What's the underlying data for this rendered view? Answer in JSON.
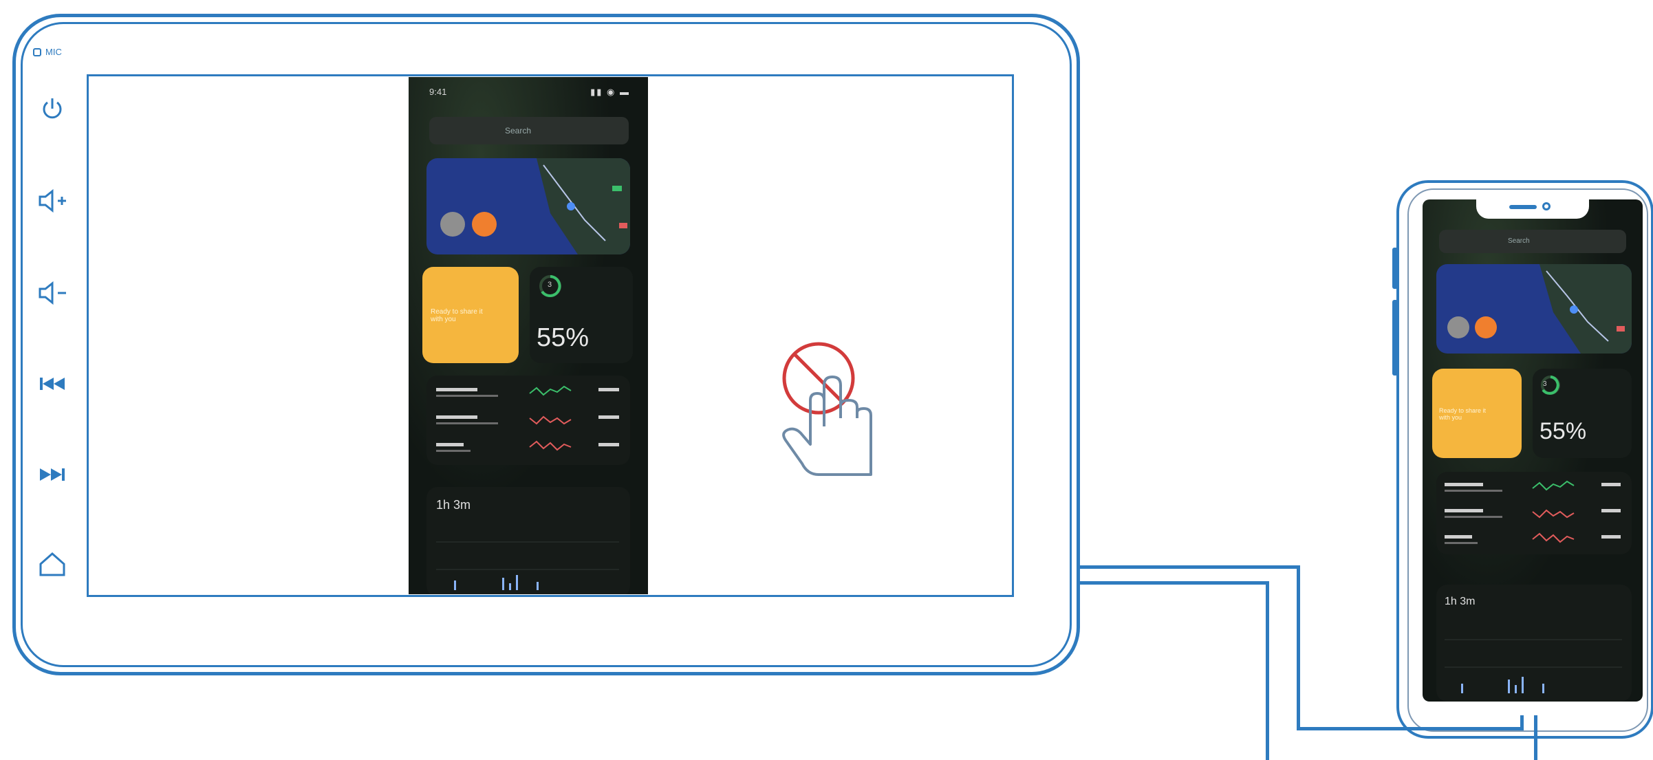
{
  "head_unit": {
    "mic_label": "MIC",
    "side_buttons": [
      {
        "name": "power-icon"
      },
      {
        "name": "volume-up-icon"
      },
      {
        "name": "volume-down-icon"
      },
      {
        "name": "previous-track-icon"
      },
      {
        "name": "next-track-icon"
      },
      {
        "name": "home-icon"
      }
    ],
    "no_touch_icon": "no-touch-icon"
  },
  "phone_screen": {
    "status_time": "9:41",
    "search_placeholder": "Search",
    "battery_percent": "55%",
    "battery_number": "3",
    "sticky_note": "Ready to share it with you",
    "duration": "1h 3m"
  },
  "colors": {
    "outline": "#2e7bbf",
    "no_touch_red": "#d23b3b",
    "widget_orange": "#f5b63e",
    "map_blue": "#233a8a"
  }
}
